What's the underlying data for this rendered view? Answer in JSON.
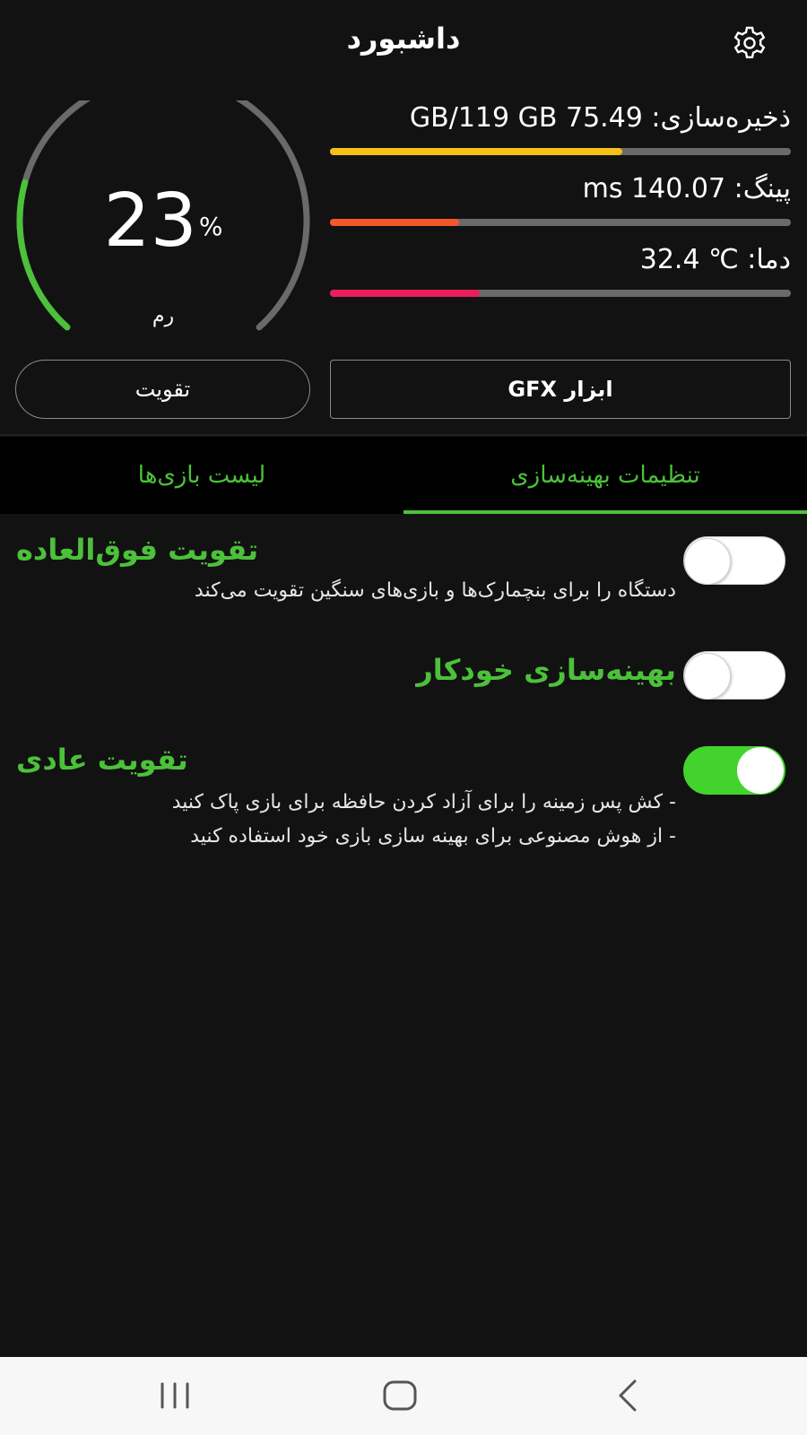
{
  "header": {
    "title": "داشبورد",
    "settings_icon": "gear-icon"
  },
  "gauge": {
    "value": "23",
    "unit": "%",
    "fraction": 0.23,
    "label": "رم",
    "color": "#4cc13a"
  },
  "stats": [
    {
      "text": "ذخیره‌سازی: GB/119 GB 75.49",
      "fraction": 0.634,
      "color": "#f5c018"
    },
    {
      "text": "پینگ: ms 140.07",
      "fraction": 0.28,
      "color": "#f4572a"
    },
    {
      "text": "دما: ℃ 32.4",
      "fraction": 0.324,
      "color": "#e91e5a"
    }
  ],
  "buttons": {
    "boost_label": "تقویت",
    "gfx_label": "ابزار GFX"
  },
  "tabs": {
    "optimize_label": "تنظیمات بهینه‌سازی",
    "games_label": "لیست بازی‌ها"
  },
  "settings": {
    "super_boost": {
      "title": "تقویت فوق‌العاده",
      "desc": "دستگاه را برای بنچمارک‌ها و بازی‌های سنگین تقویت می‌کند",
      "enabled": false
    },
    "auto_optimize": {
      "title": "بهینه‌سازی خودکار",
      "enabled": false
    },
    "normal_boost": {
      "title": "تقویت عادی",
      "desc_line1": "- کش پس زمینه را برای آزاد کردن حافظه برای بازی پاک کنید",
      "desc_line2": "- از هوش مصنوعی برای بهینه سازی بازی خود استفاده کنید",
      "enabled": true
    }
  },
  "colors": {
    "accent": "#4cc13a",
    "toggle_on": "#43d32d",
    "background": "#121212"
  },
  "navbar": {
    "recents_icon": "recents-icon",
    "home_icon": "home-icon",
    "back_icon": "back-icon"
  }
}
